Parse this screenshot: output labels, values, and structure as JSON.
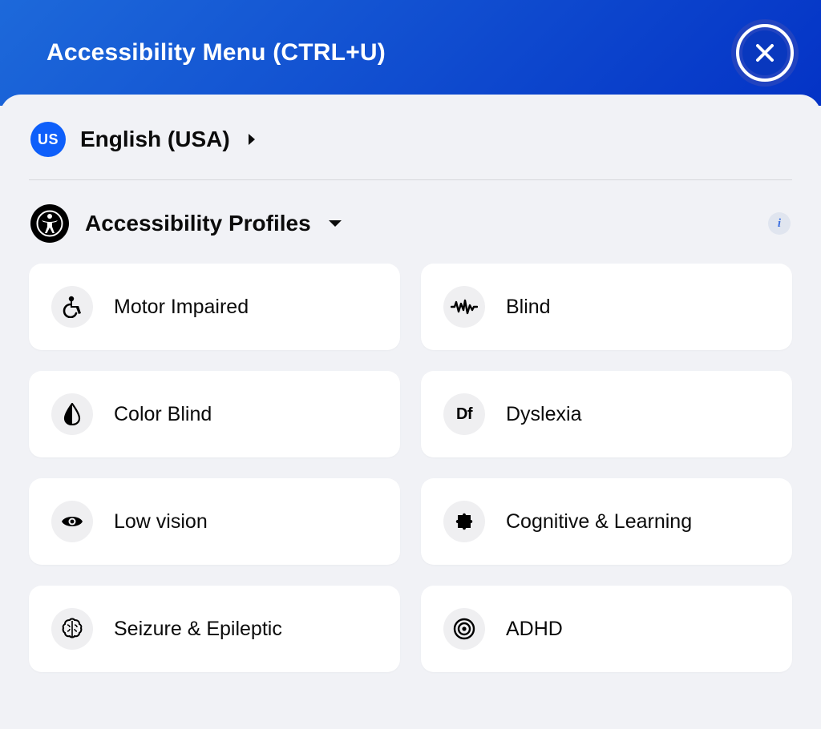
{
  "header": {
    "title": "Accessibility Menu (CTRL+U)"
  },
  "language": {
    "flag": "US",
    "label": "English (USA)"
  },
  "profiles": {
    "title": "Accessibility Profiles",
    "info_glyph": "i",
    "items": [
      {
        "icon": "wheelchair-icon",
        "label": "Motor Impaired"
      },
      {
        "icon": "wave-icon",
        "label": "Blind"
      },
      {
        "icon": "droplet-icon",
        "label": "Color Blind"
      },
      {
        "icon": "df-icon",
        "glyph": "Df",
        "label": "Dyslexia"
      },
      {
        "icon": "eye-icon",
        "label": "Low vision"
      },
      {
        "icon": "puzzle-icon",
        "label": "Cognitive & Learning"
      },
      {
        "icon": "brain-icon",
        "label": "Seizure & Epileptic"
      },
      {
        "icon": "target-icon",
        "label": "ADHD"
      }
    ]
  }
}
